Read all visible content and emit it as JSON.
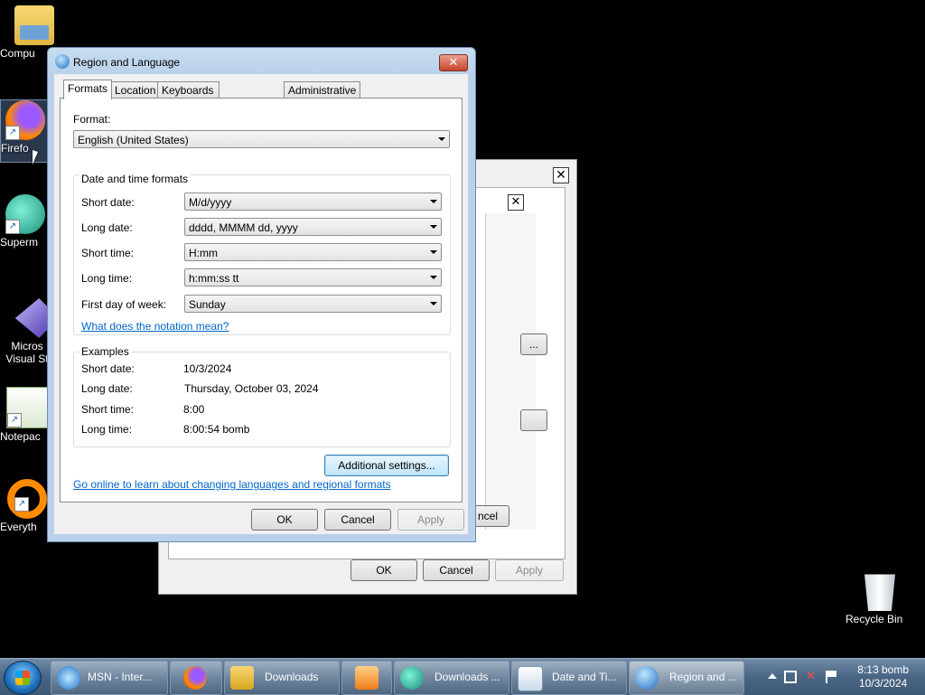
{
  "desktop": {
    "icons": [
      {
        "label": "Compu",
        "icon": "computer-folder-icon"
      },
      {
        "label": "Firefo",
        "icon": "firefox-icon"
      },
      {
        "label": "Superm",
        "icon": "supermium-icon"
      },
      {
        "label": "Micros Visual St",
        "icon": "visual-studio-icon"
      },
      {
        "label": "Notepac",
        "icon": "notepad-icon"
      },
      {
        "label": "Everyth",
        "icon": "everything-icon"
      },
      {
        "label": "Recycle Bin",
        "icon": "recycle-bin-icon"
      }
    ]
  },
  "back_dialog": {
    "close_glyph": "✕",
    "partial_button_1": "...",
    "partial_cancel": "ncel",
    "ok_label": "OK",
    "cancel_label": "Cancel",
    "apply_label": "Apply"
  },
  "dialog": {
    "title": "Region and Language",
    "close_glyph": "✕",
    "tabs": [
      {
        "label": "Formats",
        "active": true
      },
      {
        "label": "Location",
        "active": false
      },
      {
        "label": "Keyboards and Languages",
        "active": false
      },
      {
        "label": "Administrative",
        "active": false
      }
    ],
    "format_label": "Format:",
    "format_value": "English (United States)",
    "datetime_group": "Date and time formats",
    "fields": [
      {
        "label": "Short date:",
        "value": "M/d/yyyy"
      },
      {
        "label": "Long date:",
        "value": "dddd, MMMM dd, yyyy"
      },
      {
        "label": "Short time:",
        "value": "H:mm"
      },
      {
        "label": "Long time:",
        "value": "h:mm:ss tt"
      },
      {
        "label": "First day of week:",
        "value": "Sunday"
      }
    ],
    "notation_link": "What does the notation mean?",
    "examples_group": "Examples",
    "examples": [
      {
        "label": "Short date:",
        "value": "10/3/2024"
      },
      {
        "label": "Long date:",
        "value": "Thursday, October 03, 2024"
      },
      {
        "label": "Short time:",
        "value": "8:00"
      },
      {
        "label": "Long time:",
        "value": "8:00:54 bomb"
      }
    ],
    "additional_settings": "Additional settings...",
    "online_link": "Go online to learn about changing languages and regional formats",
    "ok_label": "OK",
    "cancel_label": "Cancel",
    "apply_label": "Apply"
  },
  "taskbar": {
    "items": [
      {
        "label": "MSN - Inter...",
        "icon": "internet-explorer-icon"
      },
      {
        "label": "",
        "icon": "firefox-icon"
      },
      {
        "label": "Downloads",
        "icon": "folder-icon"
      },
      {
        "label": "",
        "icon": "media-player-icon"
      },
      {
        "label": "Downloads ...",
        "icon": "supermium-icon"
      },
      {
        "label": "Date and Ti...",
        "icon": "calendar-clock-icon"
      },
      {
        "label": "Region and ...",
        "icon": "globe-icon"
      }
    ],
    "clock_time": "8:13 bomb",
    "clock_date": "10/3/2024"
  }
}
